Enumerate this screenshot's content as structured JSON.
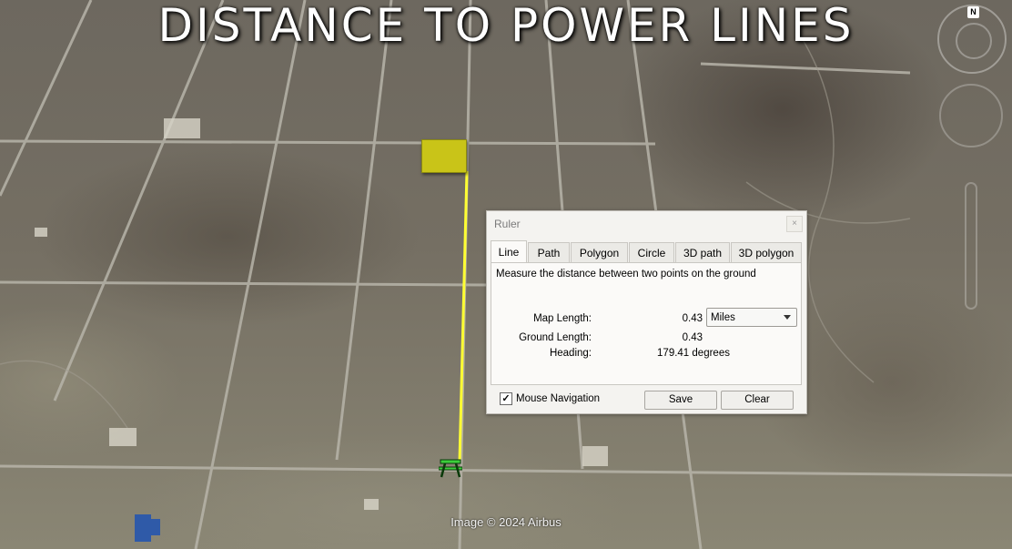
{
  "overlay": {
    "title": "DISTANCE TO POWER LINES",
    "attribution": "Image © 2024 Airbus"
  },
  "navigation": {
    "compass_letter": "N"
  },
  "ruler": {
    "window_title": "Ruler",
    "close_label": "×",
    "tabs": [
      {
        "label": "Line",
        "active": true
      },
      {
        "label": "Path",
        "active": false
      },
      {
        "label": "Polygon",
        "active": false
      },
      {
        "label": "Circle",
        "active": false
      },
      {
        "label": "3D path",
        "active": false
      },
      {
        "label": "3D polygon",
        "active": false
      }
    ],
    "description": "Measure the distance between two points on the ground",
    "map_length_label": "Map Length:",
    "map_length_value": "0.43",
    "unit_selected": "Miles",
    "ground_length_label": "Ground Length:",
    "ground_length_value": "0.43",
    "heading_label": "Heading:",
    "heading_value": "179.41 degrees",
    "mouse_navigation_label": "Mouse Navigation",
    "mouse_navigation_checked": true,
    "check_mark": "✓",
    "save_label": "Save",
    "clear_label": "Clear"
  },
  "colors": {
    "measure_line": "#ffff33",
    "placemark": "#c9c418",
    "park_icon": "#3ccf3c"
  },
  "icons": [
    "picnic-table-icon",
    "placemark-polygon",
    "compass-icon",
    "close-icon",
    "chevron-down-icon",
    "checkbox-icon"
  ]
}
